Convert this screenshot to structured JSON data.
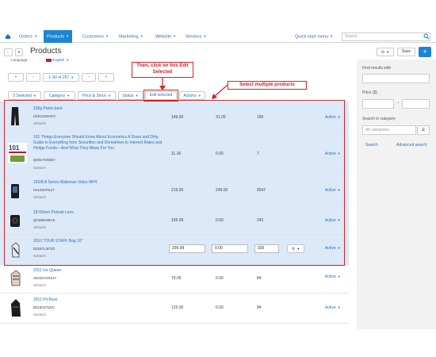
{
  "nav": {
    "items": [
      {
        "label": "Orders"
      },
      {
        "label": "Products"
      },
      {
        "label": "Customers"
      },
      {
        "label": "Marketing"
      },
      {
        "label": "Website"
      },
      {
        "label": "Vendors"
      }
    ],
    "quick_start": "Quick start menu",
    "search_placeholder": "Search"
  },
  "page": {
    "title": "Products",
    "save_label": "Save",
    "language_label": "Language:",
    "language_value": "English"
  },
  "pagination": {
    "range": "1–50 of 257"
  },
  "toolbar": {
    "selected": "5 Selected",
    "category": "Category",
    "price_stock": "Price & Stock",
    "status": "Status",
    "edit_selected": "Edit selected",
    "actions": "Actions"
  },
  "callouts": {
    "edit": "Then, click on this Edit Selected",
    "select": "Select multiple products"
  },
  "products": [
    {
      "name": "100g Pants best",
      "sku": "U0012O5AFO",
      "vendor": "Simtech",
      "price": "149.00",
      "list_price": "31.00",
      "qty": "189",
      "status": "Active",
      "selected": true
    },
    {
      "name": "101 Things Everyone Should Know About Economics A Down and Dirty Guide to Everything from Securities and Derivatives to Interest Rates and Hedge Funds—And What They Mean For You",
      "sku": "Q0017HS6EV",
      "vendor": "Simtech",
      "price": "11.16",
      "list_price": "0.00",
      "qty": "7",
      "status": "Active",
      "selected": true
    },
    {
      "name": "16GB A Series Walkman Video MP4",
      "sku": "H0148VPS1T",
      "vendor": "Simtech",
      "price": "219.00",
      "list_price": "249.00",
      "qty": "9547",
      "status": "Active",
      "selected": true
    },
    {
      "name": "18-55mm Portrait Lens",
      "sku": "Q0180S2BVS",
      "vendor": "Simtech",
      "price": "199.99",
      "list_price": "0.00",
      "qty": "242",
      "status": "Active",
      "selected": true
    },
    {
      "name": "2010 TOUR STAFF Bag 10\"",
      "sku": "D0187LXFZO",
      "vendor": "Simtech",
      "price": "299.99",
      "list_price": "0.00",
      "qty": "930",
      "status": "Active",
      "selected": true
    },
    {
      "name": "2011 Ice Queen",
      "sku": "S0232AVRZ1Y",
      "vendor": "Simtech",
      "price": "79.95",
      "list_price": "0.00",
      "qty": "84",
      "status": "Active",
      "selected": false
    },
    {
      "name": "2011 Pit Boss",
      "sku": "B0230S7Q0V",
      "vendor": "Simtech",
      "price": "125.00",
      "list_price": "0.00",
      "qty": "84",
      "status": "Active",
      "selected": false
    }
  ],
  "sidebar": {
    "find_label": "Find results with",
    "price_label": "Price ($)",
    "price_sep": "-",
    "category_label": "Search in category",
    "category_value": "All categories",
    "search_button": "Search",
    "advanced": "Advanced search"
  },
  "colors": {
    "accent": "#1a86d3",
    "callout": "#d0232a",
    "selected_row": "#dbe9f8"
  }
}
